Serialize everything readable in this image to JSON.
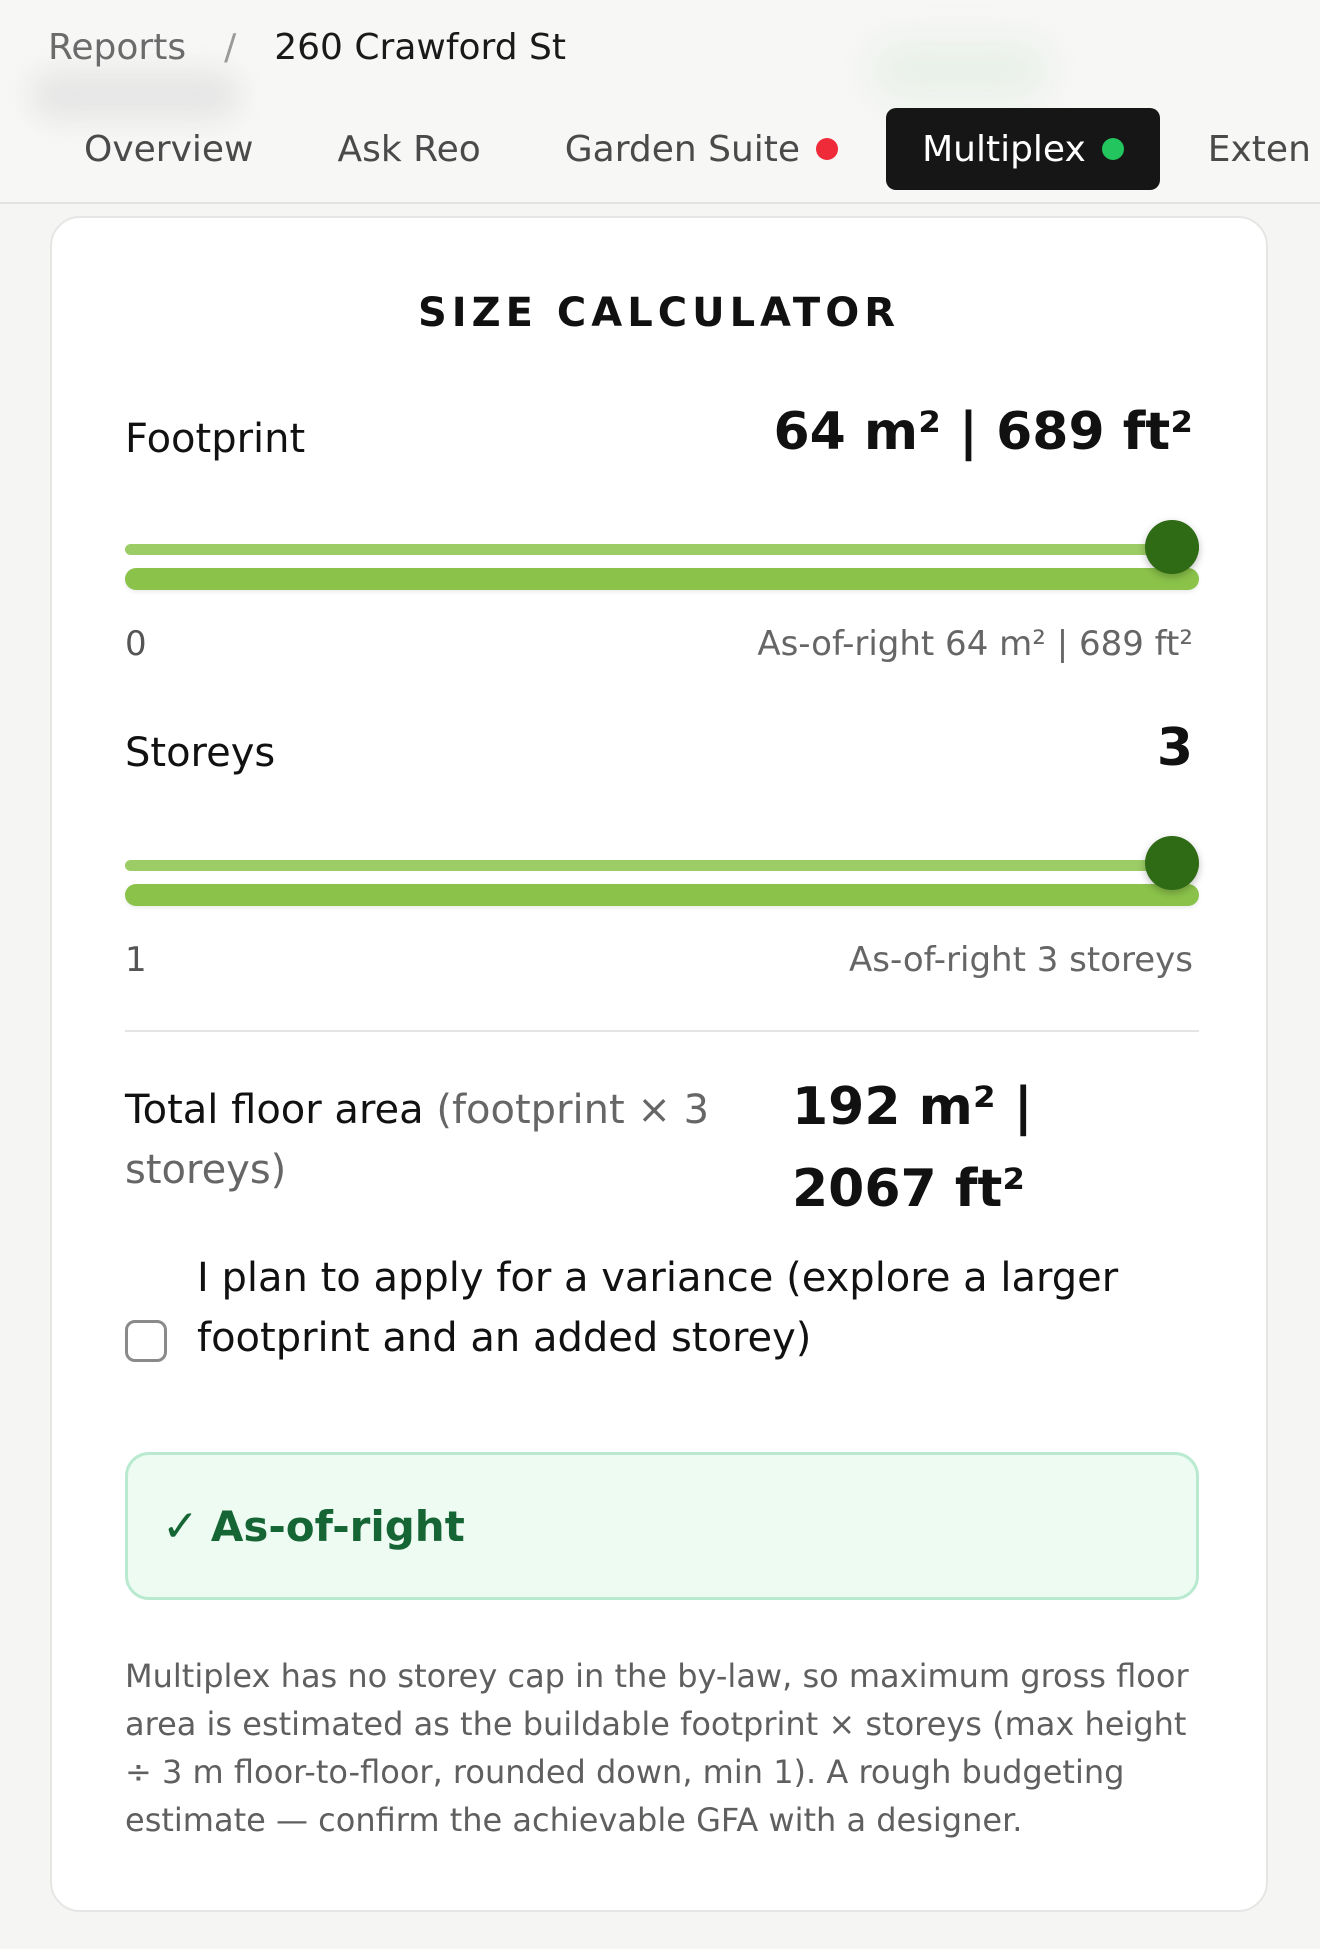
{
  "breadcrumb": {
    "root": "Reports",
    "separator": "/",
    "current": "260 Crawford St"
  },
  "tabs": [
    {
      "label": "Overview",
      "active": false
    },
    {
      "label": "Ask Reo",
      "active": false
    },
    {
      "label": "Garden Suite",
      "active": false,
      "dot": "red"
    },
    {
      "label": "Multiplex",
      "active": true,
      "dot": "green"
    },
    {
      "label": "Exten",
      "active": false
    }
  ],
  "calculator": {
    "title": "SIZE CALCULATOR",
    "footprint": {
      "label": "Footprint",
      "value": "64 m² | 689 ft²",
      "min_label": "0",
      "max_label": "As-of-right 64 m² | 689 ft²",
      "level_percent": 100
    },
    "storeys": {
      "label": "Storeys",
      "value": "3",
      "min_label": "1",
      "max_label": "As-of-right 3 storeys",
      "level_percent": 100
    },
    "total": {
      "label": "Total floor area",
      "hint": "(footprint × 3 storeys)",
      "value": "192 m² | 2067 ft²"
    },
    "variance": {
      "label": "I plan to apply for a variance (explore a larger footprint and an added storey)",
      "checked": false
    },
    "status": {
      "check": "✓",
      "text": "As-of-right"
    },
    "note": "Multiplex has no storey cap in the by-law, so maximum gross floor area is estimated as the buildable footprint × storeys (max height ÷ 3 m floor-to-floor, rounded down, min 1). A rough budgeting estimate — confirm the achievable GFA with a designer."
  },
  "colors": {
    "accent_dark": "#161616",
    "slider_track": "#8bc34a",
    "slider_thumb": "#2f6a14",
    "status_green": "#166534",
    "status_bg": "#edfbf2",
    "dot_red": "#ef2b3a",
    "dot_green": "#22c55e"
  }
}
